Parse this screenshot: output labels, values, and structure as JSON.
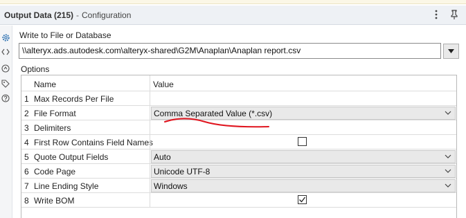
{
  "header": {
    "title": "Output Data (215)",
    "separator": "-",
    "subtitle": "Configuration",
    "icons": [
      "more-vertical-icon",
      "pin-icon"
    ]
  },
  "left_rail": {
    "icons": [
      "gear-icon",
      "code-brackets-icon",
      "annotation-icon",
      "tag-icon",
      "help-icon"
    ]
  },
  "write": {
    "label": "Write to File or Database",
    "path": "\\\\alteryx.ads.autodesk.com\\alteryx-shared\\G2M\\Anaplan\\Anaplan report.csv"
  },
  "options": {
    "label": "Options",
    "columns": {
      "name": "Name",
      "value": "Value"
    },
    "rows": [
      {
        "num": "1",
        "name": "Max Records Per File",
        "type": "text",
        "value": ""
      },
      {
        "num": "2",
        "name": "File Format",
        "type": "select",
        "value": "Comma Separated Value (*.csv)"
      },
      {
        "num": "3",
        "name": "Delimiters",
        "type": "text",
        "value": ""
      },
      {
        "num": "4",
        "name": "First Row Contains Field Names",
        "type": "checkbox",
        "checked": false
      },
      {
        "num": "5",
        "name": "Quote Output Fields",
        "type": "select",
        "value": "Auto"
      },
      {
        "num": "6",
        "name": "Code Page",
        "type": "select",
        "value": "Unicode UTF-8"
      },
      {
        "num": "7",
        "name": "Line Ending Style",
        "type": "select",
        "value": "Windows"
      },
      {
        "num": "8",
        "name": "Write BOM",
        "type": "checkbox",
        "checked": true
      }
    ]
  },
  "colors": {
    "annotation_red": "#e0141e",
    "rail_icon_blue": "#2a6fb0",
    "select_bg": "#e9e9e9"
  }
}
